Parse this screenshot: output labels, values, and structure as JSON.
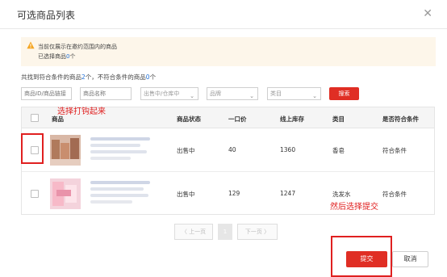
{
  "dialog": {
    "title": "可选商品列表",
    "close_glyph": "✕"
  },
  "notice": {
    "line1": "当前仅展示在邀约范围内的商品",
    "line2_prefix": "已选择商品",
    "line2_count": "0",
    "line2_suffix": "个",
    "icon": "warning-triangle-icon",
    "bg_color": "#fdf6ea"
  },
  "found": {
    "prefix": "共找到符合条件的商品",
    "count": "2",
    "mid": "个，不符合条件的商品",
    "count2": "0",
    "suffix": "个"
  },
  "filters": {
    "id_placeholder": "商品ID/商品链接",
    "name_placeholder": "商品名称",
    "status_select": "出售中/仓库中",
    "brand_select": "品牌",
    "category_select": "类目",
    "search_label": "搜索"
  },
  "table": {
    "headers": [
      "商品",
      "商品状态",
      "一口价",
      "线上库存",
      "类目",
      "是否符合条件"
    ],
    "rows": [
      {
        "status": "出售中",
        "price": "40",
        "stock": "1360",
        "category": "香皂",
        "eligible": "符合条件"
      },
      {
        "status": "出售中",
        "price": "129",
        "stock": "1247",
        "category": "洗发水",
        "eligible": "符合条件"
      }
    ]
  },
  "annotations": {
    "checkbox_hint": "选择打钩起来",
    "submit_hint": "然后选择提交",
    "color": "#e02020"
  },
  "pager": {
    "prev": "〈 上一页",
    "current": "1",
    "next": "下一页 〉"
  },
  "actions": {
    "submit": "提交",
    "cancel": "取消"
  },
  "colors": {
    "accent": "#e02e24",
    "link": "#1f6fd6"
  }
}
